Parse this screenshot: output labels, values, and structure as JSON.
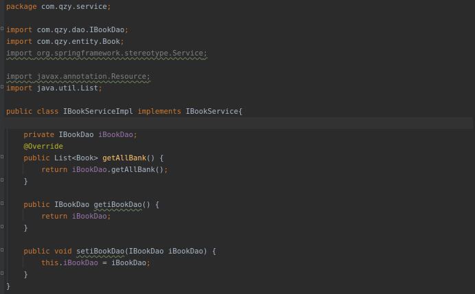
{
  "lines": [
    [
      "package",
      " com.qzy.service",
      ";"
    ],
    [],
    [
      "import",
      " com.qzy.dao.IBookDao",
      ";"
    ],
    [
      "import",
      " com.qzy.entity.Book",
      ";"
    ],
    [
      "import",
      " org.springframework.stereotype.Service",
      ";"
    ],
    [],
    [
      "import",
      " javax.annotation.Resource",
      ";"
    ],
    [
      "import",
      " java.util.List",
      ";"
    ],
    [],
    [
      "public class",
      " IBookServiceImpl ",
      "implements",
      " IBookService",
      "{"
    ],
    [],
    [
      "    ",
      "private",
      " IBookDao ",
      "iBookDao",
      ";"
    ],
    [
      "    ",
      "@Override"
    ],
    [
      "    ",
      "public",
      " List<Book> ",
      "getAllBank",
      "() {"
    ],
    [
      "        ",
      "return",
      " ",
      "iBookDao",
      ".getAllBank()",
      ";"
    ],
    [
      "    }"
    ],
    [],
    [
      "    ",
      "public",
      " IBookDao ",
      "getiBookDao",
      "() {"
    ],
    [
      "        ",
      "return",
      " ",
      "iBookDao",
      ";"
    ],
    [
      "    }"
    ],
    [],
    [
      "    ",
      "public void",
      " ",
      "setiBookDao",
      "(IBookDao iBookDao) {"
    ],
    [
      "        ",
      "this",
      ".",
      "iBookDao",
      " = iBookDao",
      ";"
    ],
    [
      "    }"
    ],
    [
      "}"
    ]
  ]
}
